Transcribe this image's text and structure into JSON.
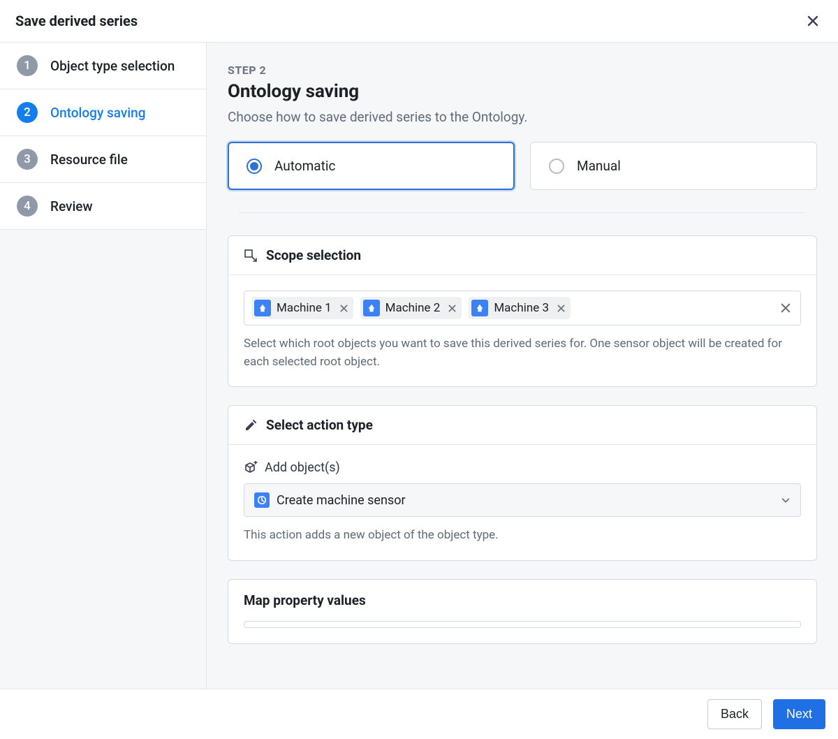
{
  "dialog": {
    "title": "Save derived series"
  },
  "sidebar": {
    "steps": [
      {
        "num": "1",
        "label": "Object type selection"
      },
      {
        "num": "2",
        "label": "Ontology saving"
      },
      {
        "num": "3",
        "label": "Resource file"
      },
      {
        "num": "4",
        "label": "Review"
      }
    ]
  },
  "content": {
    "eyebrow": "STEP 2",
    "heading": "Ontology saving",
    "subheading": "Choose how to save derived series to the Ontology.",
    "mode_options": {
      "automatic": "Automatic",
      "manual": "Manual"
    },
    "scope": {
      "title": "Scope selection",
      "tags": [
        "Machine 1",
        "Machine 2",
        "Machine 3"
      ],
      "help": "Select which root objects you want to save this derived series for. One sensor object will be created for each selected root object."
    },
    "action": {
      "title": "Select action type",
      "sub_label": "Add object(s)",
      "selected": "Create machine sensor",
      "help": "This action adds a new object of the object type."
    },
    "map": {
      "title": "Map property values"
    }
  },
  "footer": {
    "back": "Back",
    "next": "Next"
  }
}
